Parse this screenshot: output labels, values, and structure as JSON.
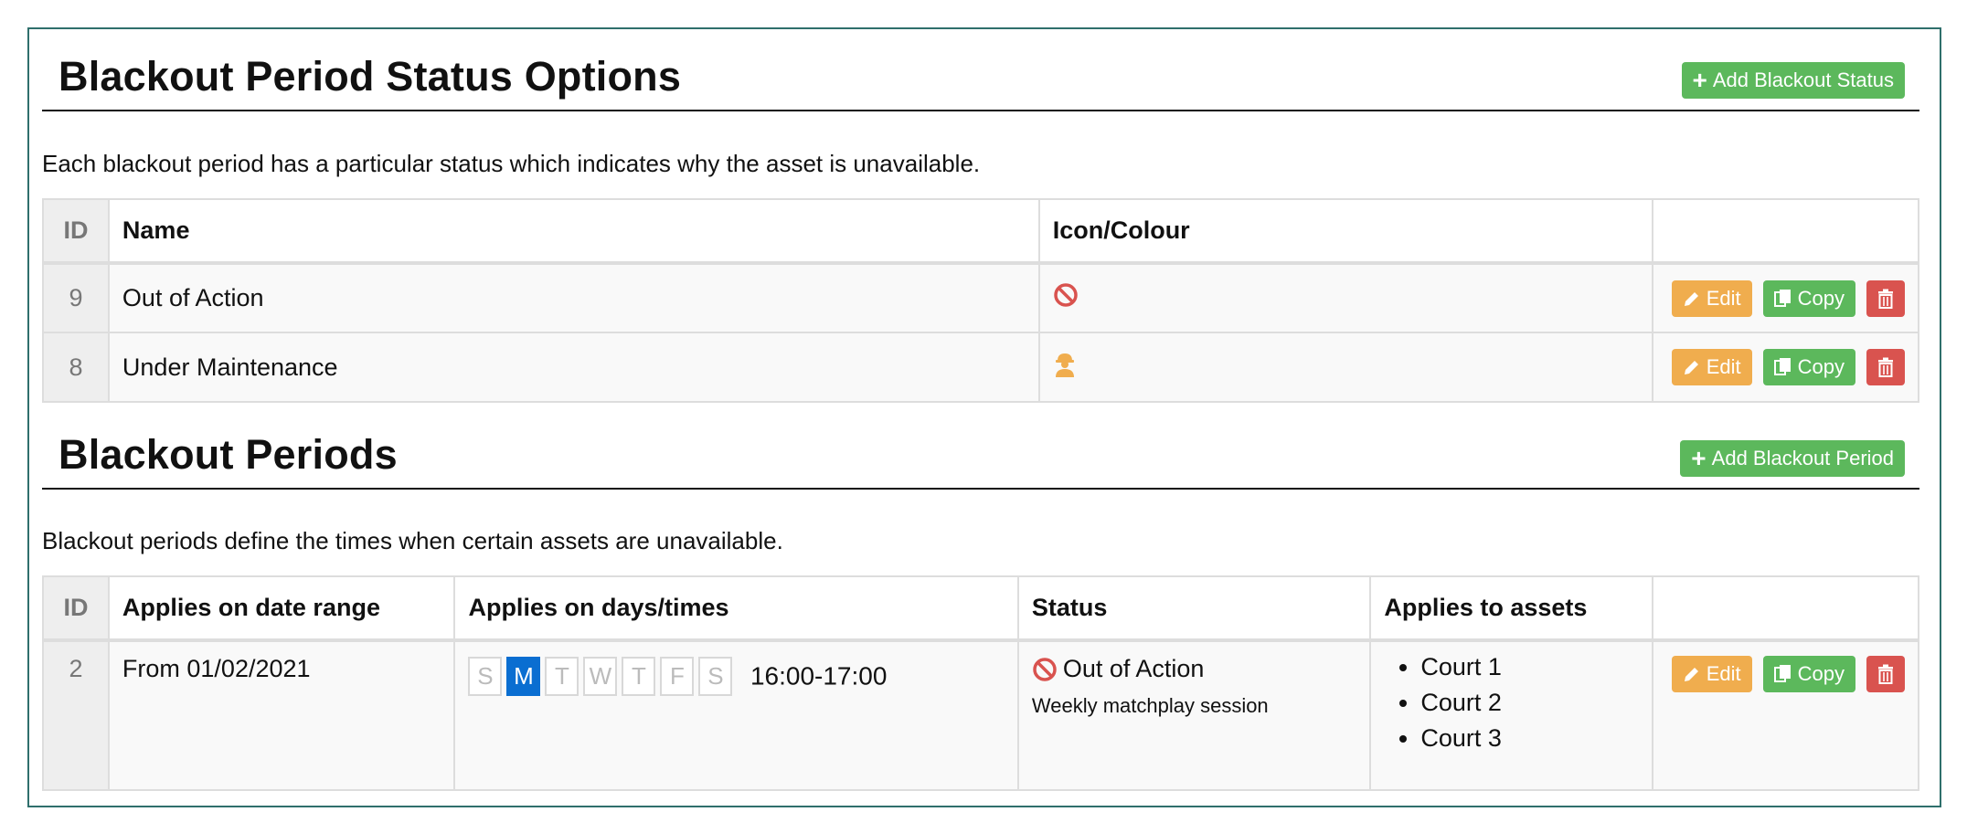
{
  "status_section": {
    "title": "Blackout Period Status Options",
    "add_button": "Add Blackout Status",
    "description": "Each blackout period has a particular status which indicates why the asset is unavailable.",
    "columns": [
      "ID",
      "Name",
      "Icon/Colour",
      ""
    ],
    "rows": [
      {
        "id": "9",
        "name": "Out of Action",
        "icon": "no-entry-icon",
        "icon_color": "#d9534f"
      },
      {
        "id": "8",
        "name": "Under Maintenance",
        "icon": "worker-icon",
        "icon_color": "#f0ad4e"
      }
    ]
  },
  "periods_section": {
    "title": "Blackout Periods",
    "add_button": "Add Blackout Period",
    "description": "Blackout periods define the times when certain assets are unavailable.",
    "columns": [
      "ID",
      "Applies on date range",
      "Applies on days/times",
      "Status",
      "Applies to assets",
      ""
    ],
    "rows": [
      {
        "id": "2",
        "date_range": "From 01/02/2021",
        "days": [
          "S",
          "M",
          "T",
          "W",
          "T",
          "F",
          "S"
        ],
        "active_day_index": 1,
        "time": "16:00-17:00",
        "status": "Out of Action",
        "status_icon": "no-entry-icon",
        "status_note": "Weekly matchplay session",
        "assets": [
          "Court 1",
          "Court 2",
          "Court 3"
        ]
      }
    ]
  },
  "actions": {
    "edit": "Edit",
    "copy": "Copy"
  },
  "colors": {
    "edit": "#f0ad4e",
    "copy": "#5cb85c",
    "delete": "#d9534f",
    "add": "#5cb85c",
    "active_day": "#0a6ed1",
    "frame": "#2f6f6c"
  }
}
